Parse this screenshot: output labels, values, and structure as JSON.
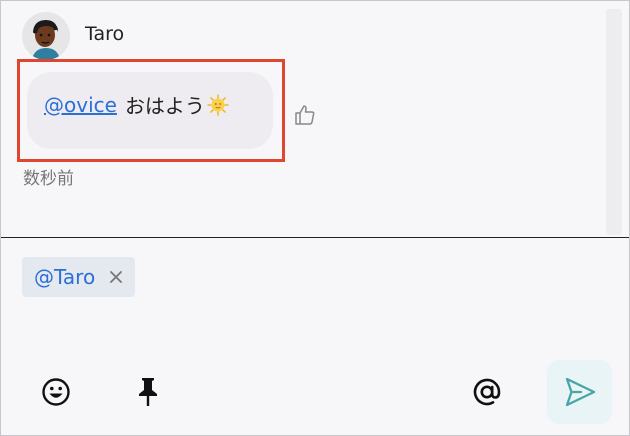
{
  "message": {
    "author": "Taro",
    "mention": "@ovice",
    "text": "おはよう",
    "timestamp": "数秒前"
  },
  "icons": {
    "avatar": "avatar-image",
    "reaction": "sun-emoji-icon",
    "like": "thumbs-up-icon",
    "emoji": "smiley-icon",
    "pin": "pin-icon",
    "mention": "at-sign-icon",
    "send": "send-arrow-icon"
  },
  "composer": {
    "mention_chip": "@Taro",
    "at_symbol": "@"
  },
  "colors": {
    "highlight_border": "#e0452f",
    "mention_link": "#2b6fd8",
    "bubble_bg": "#efecf1",
    "send_icon": "#4aa6a6",
    "send_bg": "#e8f4f5"
  }
}
